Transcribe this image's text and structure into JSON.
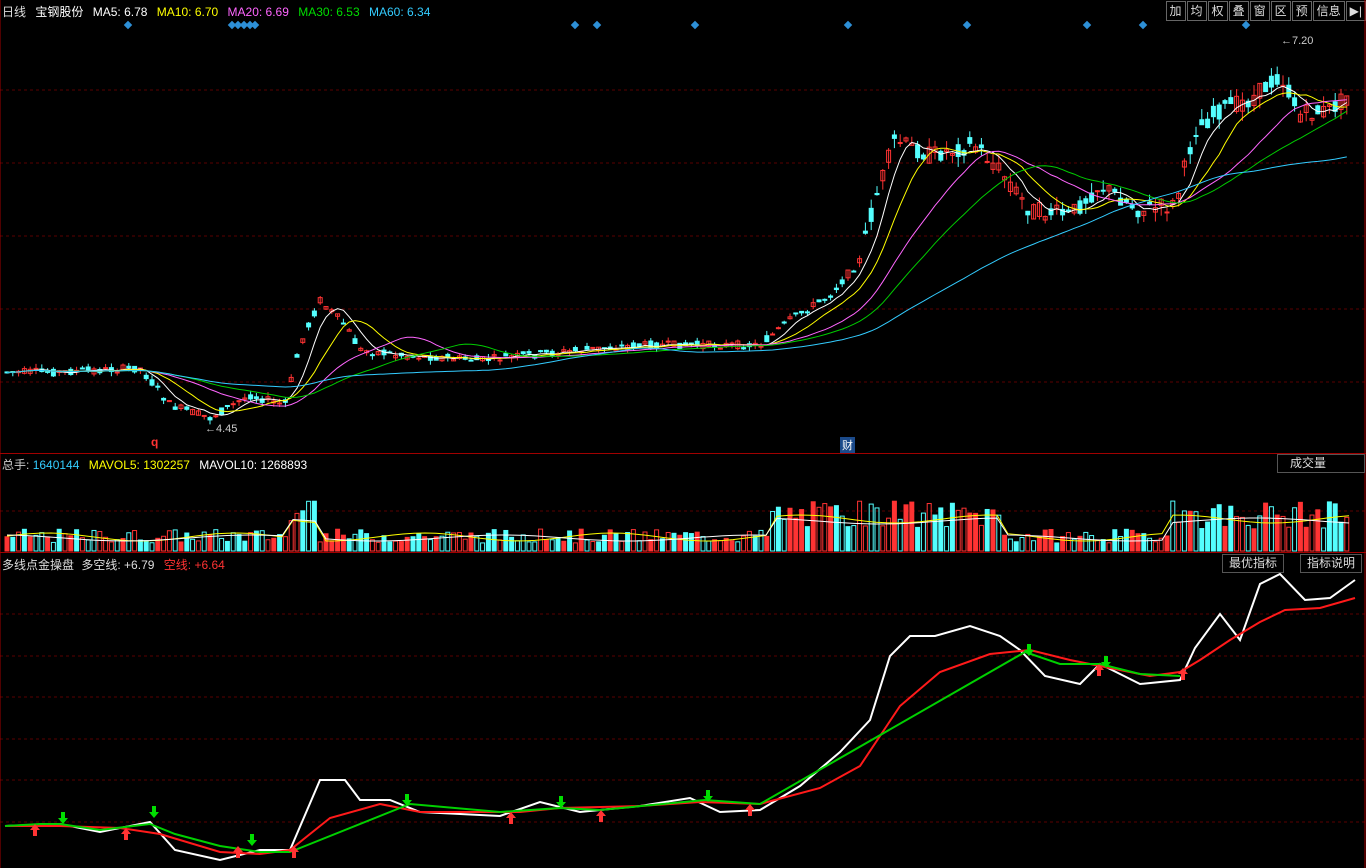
{
  "header": {
    "period": "日线",
    "stock": "宝钢股份",
    "ma5_label": "MA5:",
    "ma5": "6.78",
    "ma10_label": "MA10:",
    "ma10": "6.70",
    "ma20_label": "MA20:",
    "ma20": "6.69",
    "ma30_label": "MA30:",
    "ma30": "6.53",
    "ma60_label": "MA60:",
    "ma60": "6.34"
  },
  "toolbar": [
    "加",
    "均",
    "权",
    "叠",
    "窗",
    "区",
    "预",
    "信息",
    "▶|"
  ],
  "price_chart": {
    "high_label": "7.20",
    "low_label": "4.45",
    "marker_q": "q",
    "marker_cai": "财"
  },
  "volume": {
    "total_label": "总手:",
    "total": "1640144",
    "mavol5_label": "MAVOL5:",
    "mavol5": "1302257",
    "mavol10_label": "MAVOL10:",
    "mavol10": "1268893",
    "dropdown": "成交量",
    "dropdown_arrow": "▼"
  },
  "indicator": {
    "name": "多线点金操盘",
    "bull_label": "多空线:",
    "bull": "+6.79",
    "bear_label": "空线:",
    "bear": "+6.64",
    "best_button": "最优指标",
    "help_button": "指标说明"
  },
  "colors": {
    "ma5": "#ffffff",
    "ma10": "#ffff00",
    "ma20": "#ff66ff",
    "ma30": "#00cc00",
    "ma60": "#33ccff",
    "up": "#ff3333",
    "down": "#54ffff",
    "grid": "#5a0000"
  }
}
